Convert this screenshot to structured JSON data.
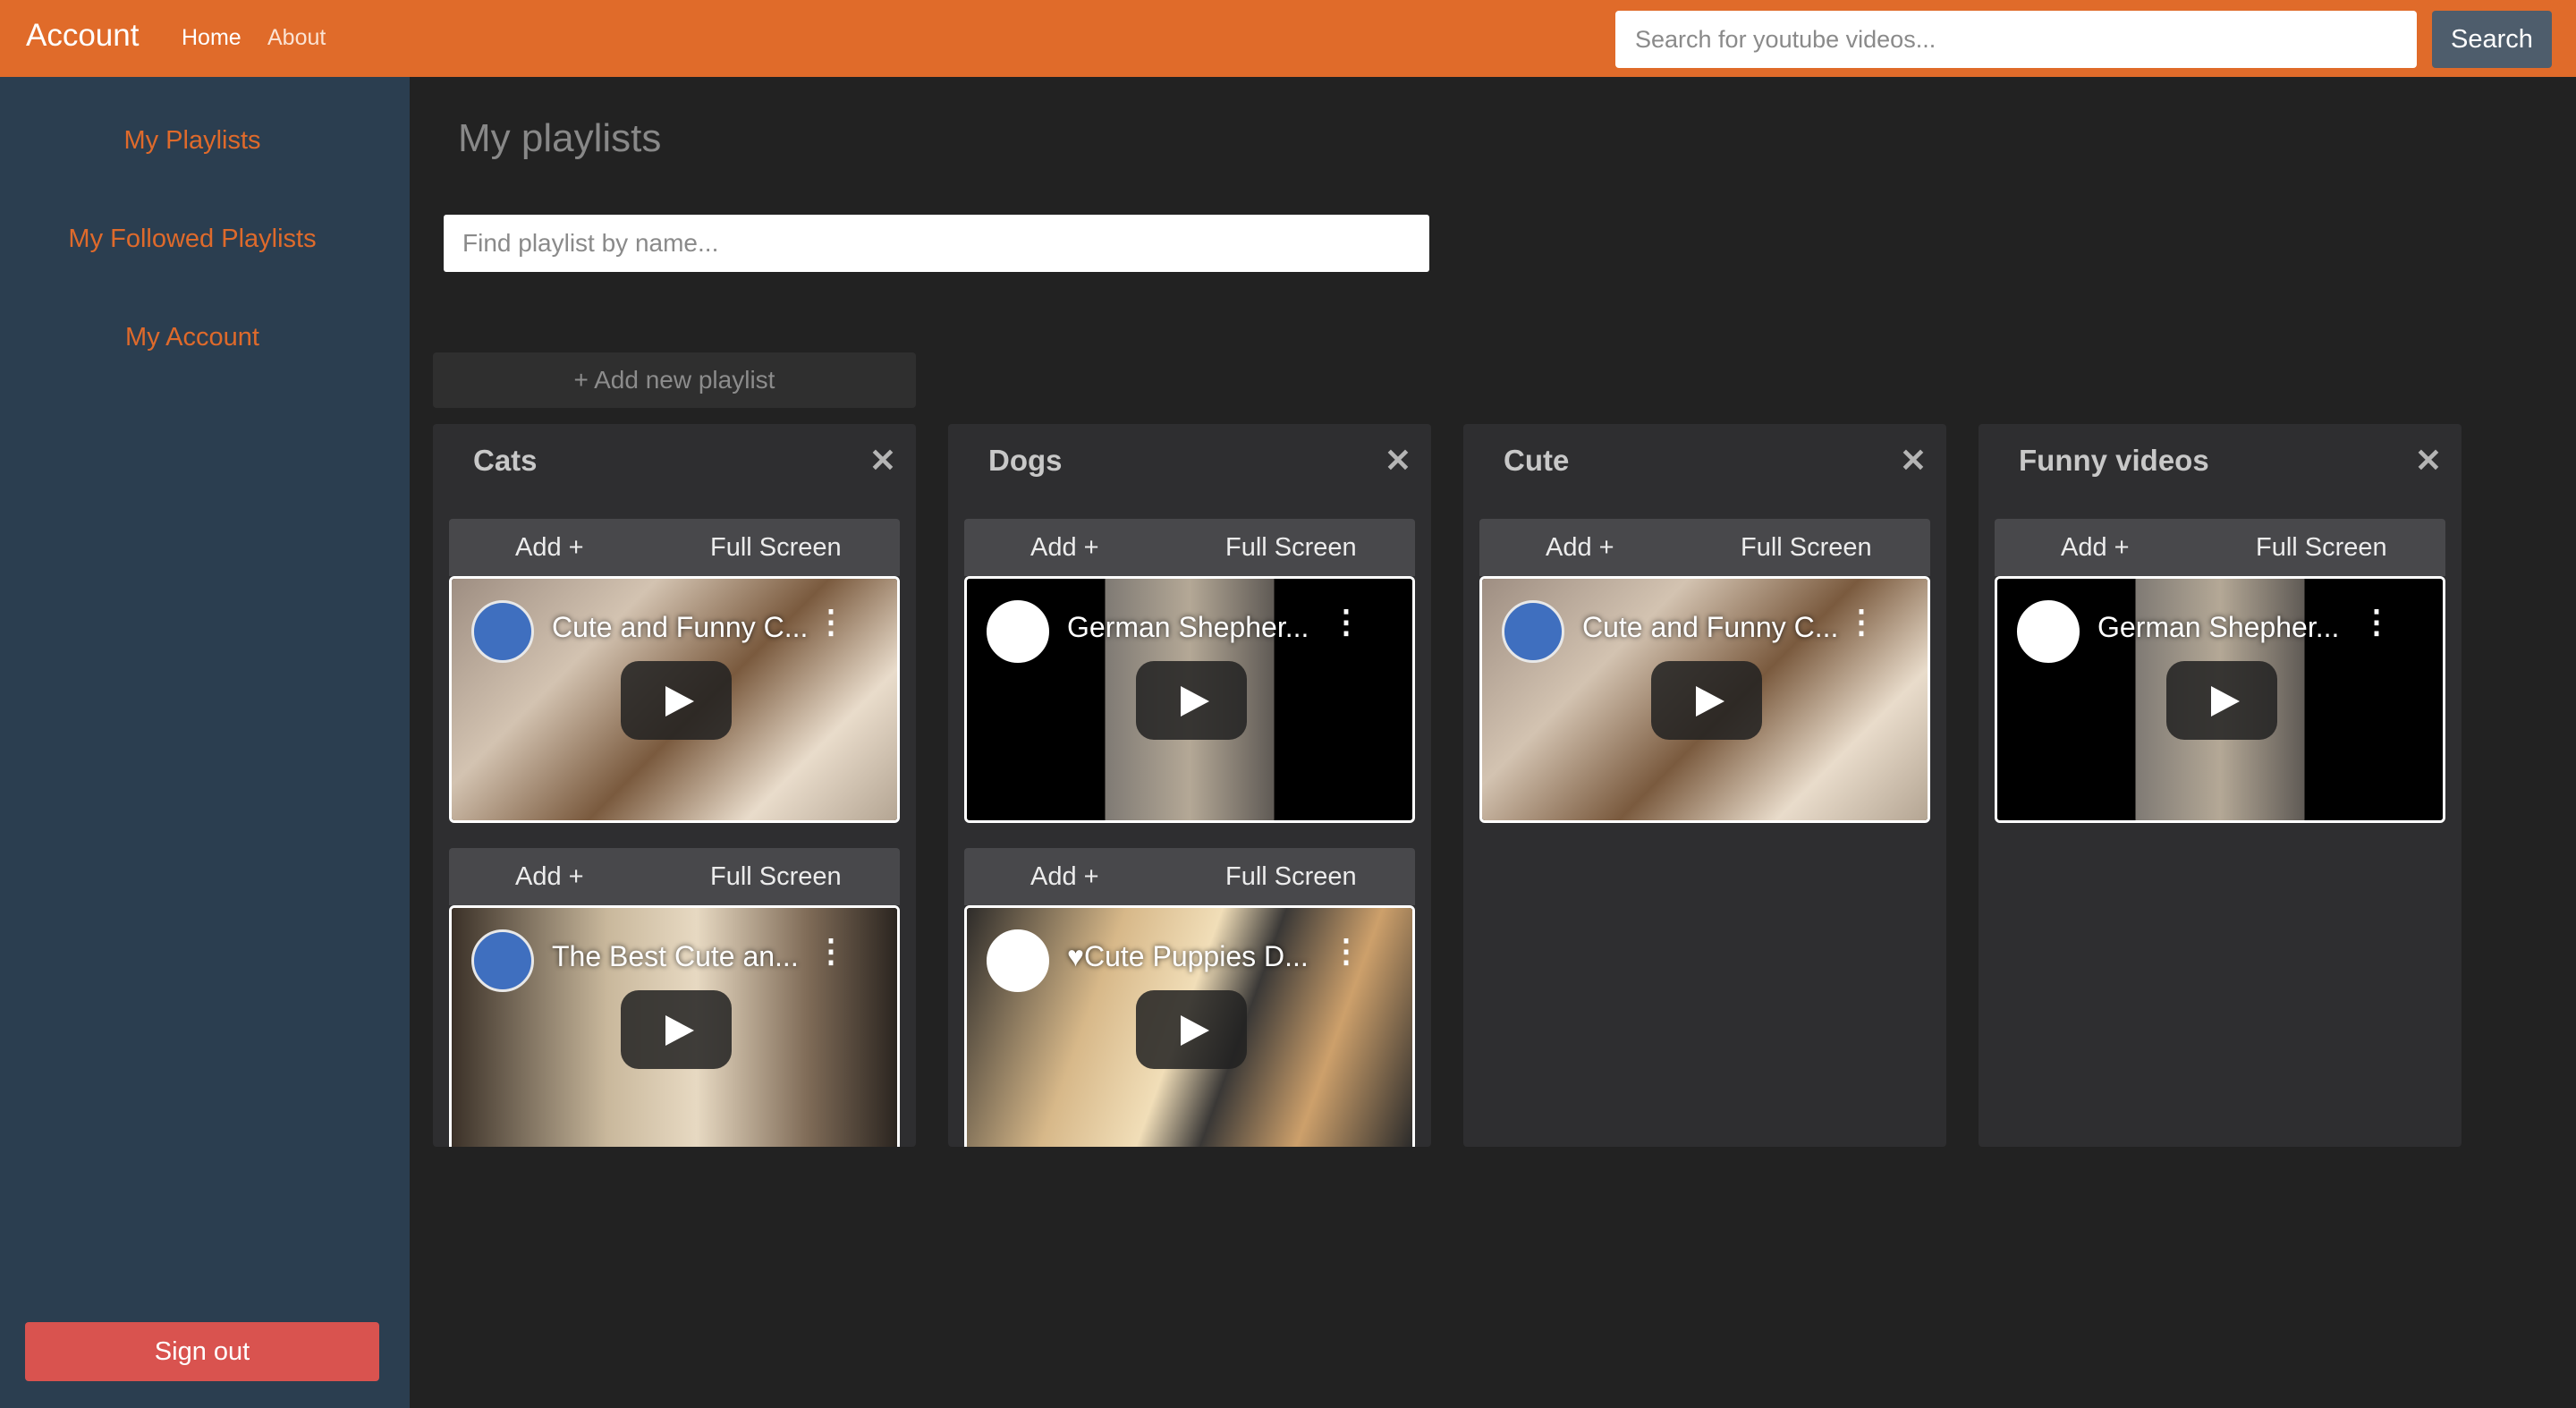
{
  "navbar": {
    "brand": "Account",
    "links": [
      "Home",
      "About"
    ],
    "search_placeholder": "Search for youtube videos...",
    "search_button": "Search",
    "color": "#e06b2a"
  },
  "sidebar": {
    "items": [
      "My Playlists",
      "My Followed Playlists",
      "My Account"
    ],
    "signout": "Sign out"
  },
  "main": {
    "title": "My playlists",
    "find_placeholder": "Find playlist by name...",
    "add_playlist": "+ Add new playlist"
  },
  "playlists": [
    {
      "name": "Cats",
      "close": "✕",
      "videos": [
        {
          "add": "Add +",
          "full": "Full Screen",
          "title": "Cute and Funny C...",
          "more": "⋮"
        },
        {
          "add": "Add +",
          "full": "Full Screen",
          "title": "The Best Cute an...",
          "more": "⋮"
        }
      ]
    },
    {
      "name": "Dogs",
      "close": "✕",
      "videos": [
        {
          "add": "Add +",
          "full": "Full Screen",
          "title": "German Shepher...",
          "more": "⋮"
        },
        {
          "add": "Add +",
          "full": "Full Screen",
          "title": "♥Cute Puppies D...",
          "more": "⋮"
        }
      ]
    },
    {
      "name": "Cute",
      "close": "✕",
      "videos": [
        {
          "add": "Add +",
          "full": "Full Screen",
          "title": "Cute and Funny C...",
          "more": "⋮"
        }
      ]
    },
    {
      "name": "Funny videos",
      "close": "✕",
      "videos": [
        {
          "add": "Add +",
          "full": "Full Screen",
          "title": "German Shepher...",
          "more": "⋮"
        }
      ]
    }
  ]
}
